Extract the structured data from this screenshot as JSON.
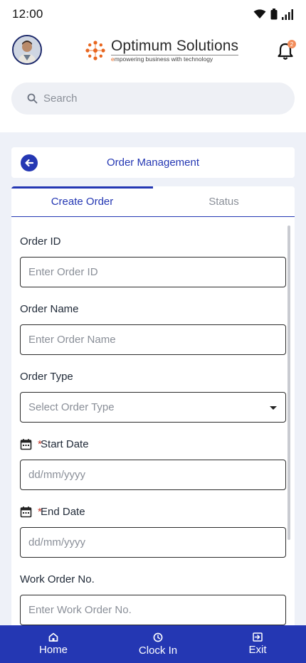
{
  "status_bar": {
    "time": "12:00"
  },
  "header": {
    "logo_title": "Optimum Solutions",
    "logo_tagline_first_letter": "e",
    "logo_tagline_rest": "mpowering business with technology",
    "notification_count": "2"
  },
  "search": {
    "placeholder": "Search"
  },
  "page": {
    "title": "Order Management"
  },
  "tabs": [
    {
      "label": "Create Order",
      "active": true
    },
    {
      "label": "Status",
      "active": false
    }
  ],
  "form": {
    "order_id": {
      "label": "Order ID",
      "placeholder": "Enter Order ID"
    },
    "order_name": {
      "label": "Order Name",
      "placeholder": "Enter Order Name"
    },
    "order_type": {
      "label": "Order Type",
      "placeholder": "Select Order Type"
    },
    "start_date": {
      "required_mark": "*",
      "label": "Start Date",
      "placeholder": "dd/mm/yyyy"
    },
    "end_date": {
      "required_mark": "*",
      "label": "End Date",
      "placeholder": "dd/mm/yyyy"
    },
    "work_order_no": {
      "label": "Work Order No.",
      "placeholder": "Enter Work Order No."
    }
  },
  "bottom_nav": [
    {
      "label": "Home",
      "icon": "home-icon"
    },
    {
      "label": "Clock In",
      "icon": "clock-icon"
    },
    {
      "label": "Exit",
      "icon": "exit-icon"
    }
  ],
  "colors": {
    "primary": "#2437b3",
    "required": "#c0392b",
    "badge": "#f28c5a",
    "background": "#eef1f8"
  }
}
